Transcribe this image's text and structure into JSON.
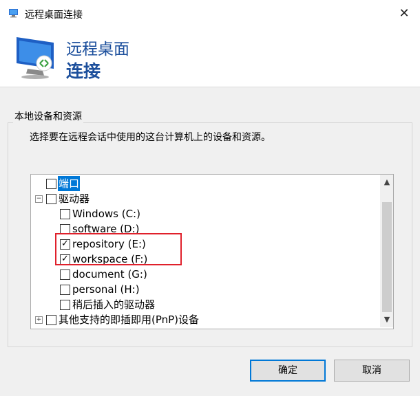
{
  "window": {
    "title": "远程桌面连接",
    "close_glyph": "✕"
  },
  "banner": {
    "line1": "远程桌面",
    "line2": "连接"
  },
  "group": {
    "legend": "本地设备和资源",
    "description": "选择要在远程会话中使用的这台计算机上的设备和资源。"
  },
  "tree": {
    "items": [
      {
        "label": "端口",
        "checked": false,
        "expander": "",
        "selected": true
      },
      {
        "label": "驱动器",
        "checked": false,
        "expander": "−"
      },
      {
        "label": "Windows (C:)",
        "checked": false
      },
      {
        "label": "software (D:)",
        "checked": false
      },
      {
        "label": "repository (E:)",
        "checked": true
      },
      {
        "label": "workspace (F:)",
        "checked": true
      },
      {
        "label": "document (G:)",
        "checked": false
      },
      {
        "label": "personal (H:)",
        "checked": false
      },
      {
        "label": "稍后插入的驱动器",
        "checked": false
      },
      {
        "label": "其他支持的即插即用(PnP)设备",
        "checked": false,
        "expander": "+"
      }
    ],
    "check_glyph": "✓",
    "scroll_up_glyph": "▲",
    "scroll_down_glyph": "▼"
  },
  "buttons": {
    "ok": "确定",
    "cancel": "取消"
  },
  "colors": {
    "accent": "#0078d7",
    "banner_text": "#1c4f9c",
    "annotation_red": "#e0202b"
  }
}
